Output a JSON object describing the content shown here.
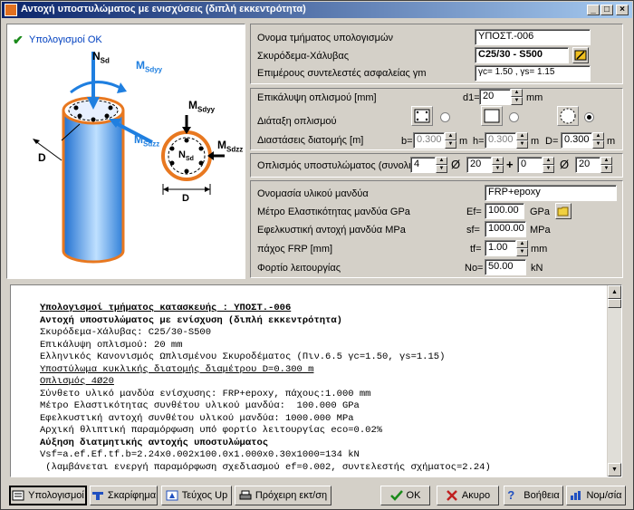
{
  "window": {
    "title": "Αντοχή υποστυλώματος με ενισχύσεις (διπλή εκκεντρότητα)"
  },
  "diagram": {
    "status": "Υπολογισμοί OK",
    "labels": {
      "nsd": "N",
      "nsd_sub": "Sd",
      "msdyy": "M",
      "msdyy_sub": "Sdyy",
      "msdzz": "M",
      "msdzz_sub": "Sdzz",
      "msdyy2": "M",
      "msdyy2_sub": "Sdyy",
      "msdzz2": "M",
      "msdzz2_sub": "Sdzz",
      "nsd2": "N",
      "nsd2_sub": "Sd",
      "d": "D",
      "d_small": "D"
    }
  },
  "form": {
    "section_name_label": "Ονομα τμήματος υπολογισμών",
    "section_name_value": "ΥΠΟΣΤ.-006",
    "concrete_label": "Σκυρόδεμα-Χάλυβας",
    "concrete_value": "C25/30 - S500",
    "safety_label": "Επιμέρους συντελεστές ασφαλείας γm",
    "safety_value": "γc= 1.50 , γs= 1.15",
    "cover_label": "Επικάλυψη οπλισμού [mm]",
    "cover_prefix": "d1=",
    "cover_value": "20",
    "cover_unit": "mm",
    "arrangement_label": "Διάταξη οπλισμού",
    "dimensions_label": "Διαστάσεις διατομής [m]",
    "b_label": "b=",
    "b_value": "0.300",
    "h_label": "h=",
    "h_value": "0.300",
    "d_label": "D=",
    "d_value": "0.300",
    "m_unit": "m",
    "reinforcement_label": "Οπλισμός υποστυλώματος (συνολικός)",
    "reinf_n1": "4",
    "reinf_d1": "20",
    "reinf_n2": "0",
    "reinf_d2": "20",
    "diameter_symbol": "Ø",
    "plus_symbol": "+",
    "jacket_name_label": "Ονομασία υλικού μανδύα",
    "jacket_name_value": "FRP+epoxy",
    "modulus_label": "Μέτρο Ελαστικότητας μανδύα GPa",
    "modulus_prefix": "Ef=",
    "modulus_value": "100.00",
    "modulus_unit": "GPa",
    "strength_label": "Εφελκυστική αντοχή μανδύα MPa",
    "strength_prefix": "sf=",
    "strength_value": "1000.00",
    "strength_unit": "MPa",
    "thickness_label": "πάχος FRP [mm]",
    "thickness_prefix": "tf=",
    "thickness_value": "1.00",
    "thickness_unit": "mm",
    "load_label": "Φορτίο λειτουργίας",
    "load_prefix": "No=",
    "load_value": "50.00",
    "load_unit": "kN"
  },
  "output": {
    "lines": [
      {
        "text": "Υπολογισμοί τμήματος κατασκευής : ΥΠΟΣΤ.-006",
        "style": "b u"
      },
      {
        "text": "Αντοχή υποστυλώματος με ενίσχυση (διπλή εκκεντρότητα)",
        "style": "b"
      },
      {
        "text": "Σκυρόδεμα-Χάλυβας: C25/30-S500",
        "style": ""
      },
      {
        "text": "Επικάλυψη οπλισμού: 20 mm",
        "style": ""
      },
      {
        "text": "Ελληνικός Κανονισμός Ωπλισμένου Σκυροδέματος (Πιν.6.5 γc=1.50, γs=1.15)",
        "style": ""
      },
      {
        "text": "Υποστύλωμα κυκλικής διατομής διαμέτρου D=0.300 m",
        "style": "u"
      },
      {
        "text": "Οπλισμός 4Ø20",
        "style": "u"
      },
      {
        "text": "Σύνθετο υλικό μανδύα ενίσχυσης: FRP+epoxy, πάχους:1.000 mm",
        "style": ""
      },
      {
        "text": "Μέτρο Ελαστικότητας συνθέτου υλικού μανδύα:  100.000 GPa",
        "style": ""
      },
      {
        "text": "Εφελκυστική αντοχή συνθέτου υλικού μανδύα: 1000.000 MPa",
        "style": ""
      },
      {
        "text": "Αρχική θλιπτική παραμόρφωση υπό φορτίο λειτουργίας eco=0.02%",
        "style": ""
      },
      {
        "text": "Αύξηση διατμητικής αντοχής υποστυλώματος",
        "style": "b"
      },
      {
        "text": "Vsf=a.ef.Ef.tf.b=2.24x0.002x100.0x1.000x0.30x1000=134 kN",
        "style": ""
      },
      {
        "text": " (λαμβάνεται ενεργή παραμόρφωση σχεδιασμού ef=0.002, συντελεστής σχήματος=2.24)",
        "style": ""
      }
    ]
  },
  "buttons": {
    "calc": "Υπολογισμοί",
    "sketch": "Σκαρίφημα",
    "report": "Τεύχος Up",
    "draft": "Πρόχειρη εκτ/ση",
    "ok": "OK",
    "cancel": "Ακυρο",
    "help": "Βοήθεια",
    "units": "Νομ/σία"
  },
  "colors": {
    "title_start": "#0a246a",
    "title_end": "#a6caf0",
    "accent_blue": "#1f7fe0",
    "jacket_orange": "#e87820",
    "ok_green": "#1a8a1a"
  }
}
